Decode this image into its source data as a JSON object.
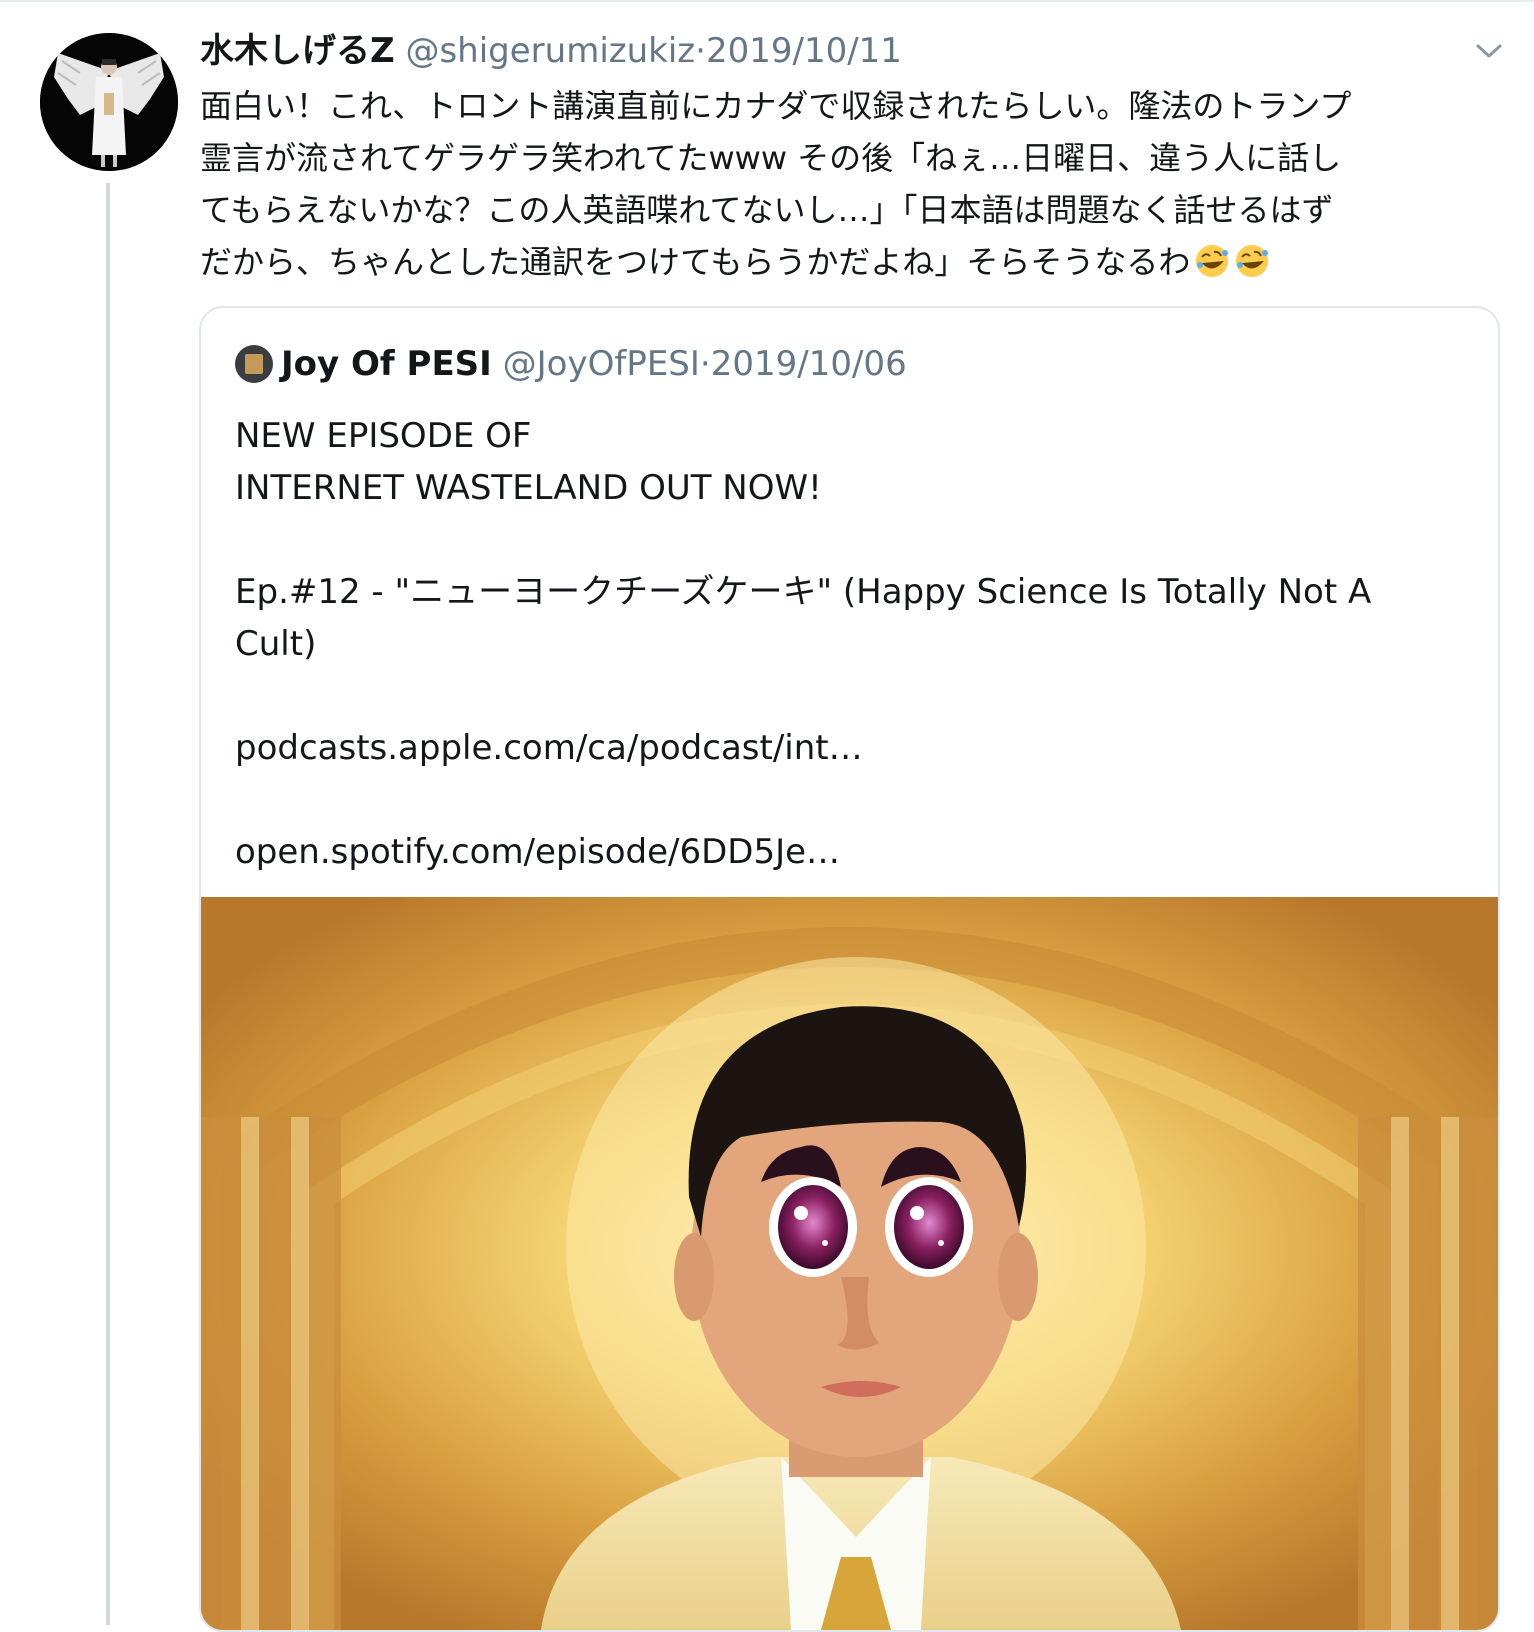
{
  "tweet": {
    "display_name": "水木しげるZ",
    "handle": "@shigerumizukiz",
    "separator": "·",
    "date": "2019/10/11",
    "text_lines": [
      "面白い！これ、トロント講演直前にカナダで収録されたらしい。隆法のトランプ",
      "霊言が流されてゲラゲラ笑われてたwww その後「ねぇ…日曜日、違う人に話し",
      "てもらえないかな？この人英語喋れてないし…」「日本語は問題なく話せるはず",
      "だから、ちゃんとした通訳をつけてもらうかだよね」そらそうなるわ"
    ],
    "emoji": [
      "rolling-on-floor-laughing-emoji",
      "rolling-on-floor-laughing-emoji"
    ],
    "menu_icon": "chevron-down-icon"
  },
  "quoted_tweet": {
    "display_name": "Joy Of PESI",
    "handle": "@JoyOfPESI",
    "separator": "·",
    "date": "2019/10/06",
    "text_lines": [
      "NEW EPISODE OF",
      "INTERNET WASTELAND OUT NOW!",
      "",
      "Ep.#12 - \"ニューヨークチーズケーキ\" (Happy Science Is Totally Not A",
      "Cult)",
      "",
      "podcasts.apple.com/ca/podcast/int…",
      "",
      "open.spotify.com/episode/6DD5Je…"
    ],
    "media": "photo-of-man-with-cartoon-eyes"
  },
  "colors": {
    "text_primary": "#14171a",
    "text_secondary": "#657786",
    "border": "#e1e8ed",
    "thread_line": "#cfd9de"
  }
}
